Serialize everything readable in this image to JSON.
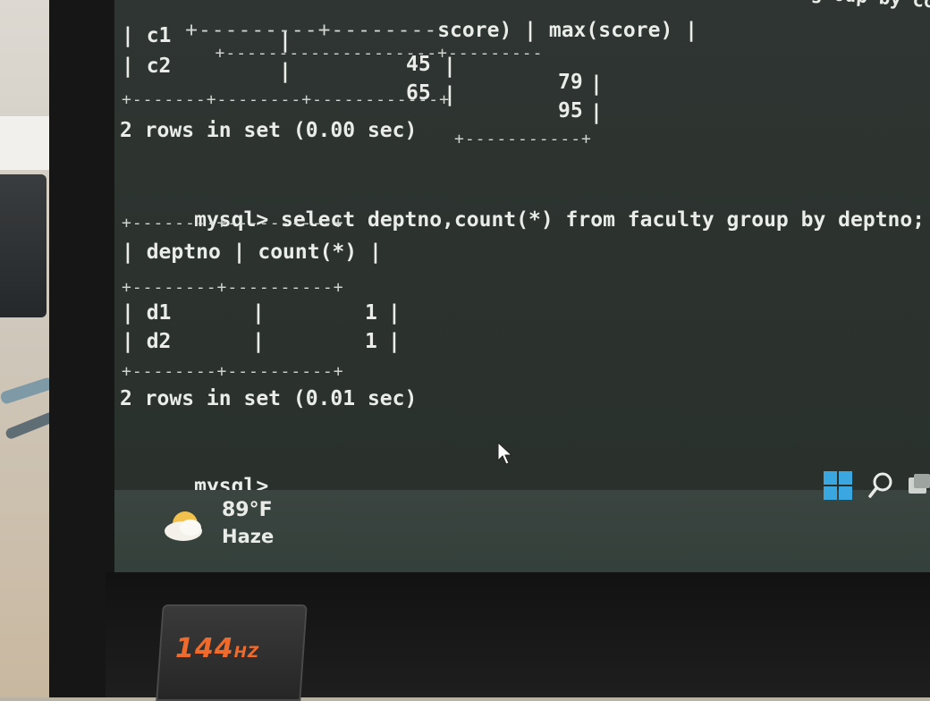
{
  "terminal": {
    "top_table": {
      "header_partial": "score)",
      "header_max": "max(score)",
      "rows": [
        {
          "course": "c1",
          "min": "45",
          "max": "79"
        },
        {
          "course": "c2",
          "min": "65",
          "max": "95"
        }
      ],
      "footer": "2 rows in set (0.00 sec)",
      "prev_query_tail": "om student group by coursen"
    },
    "query": {
      "prompt": "mysql>",
      "command": "select deptno,count(*) from faculty group by deptno;"
    },
    "result": {
      "columns": [
        "deptno",
        "count(*)"
      ],
      "rows": [
        {
          "deptno": "d1",
          "count": "1"
        },
        {
          "deptno": "d2",
          "count": "1"
        }
      ],
      "footer": "2 rows in set (0.01 sec)"
    },
    "current_prompt": "mysql>"
  },
  "taskbar": {
    "weather": {
      "icon": "haze-sun-icon",
      "temperature": "89°F",
      "condition": "Haze"
    },
    "start_icon": "windows-logo-icon",
    "search_icon": "search-icon",
    "taskview_icon": "task-view-icon"
  },
  "monitor": {
    "badge_main": "144",
    "badge_unit": "HZ",
    "badge_color": "#f06b2b"
  },
  "colors": {
    "terminal_bg": "#2c332f",
    "terminal_text": "#e9ece8",
    "windows_blue": "#3aa7e0"
  }
}
